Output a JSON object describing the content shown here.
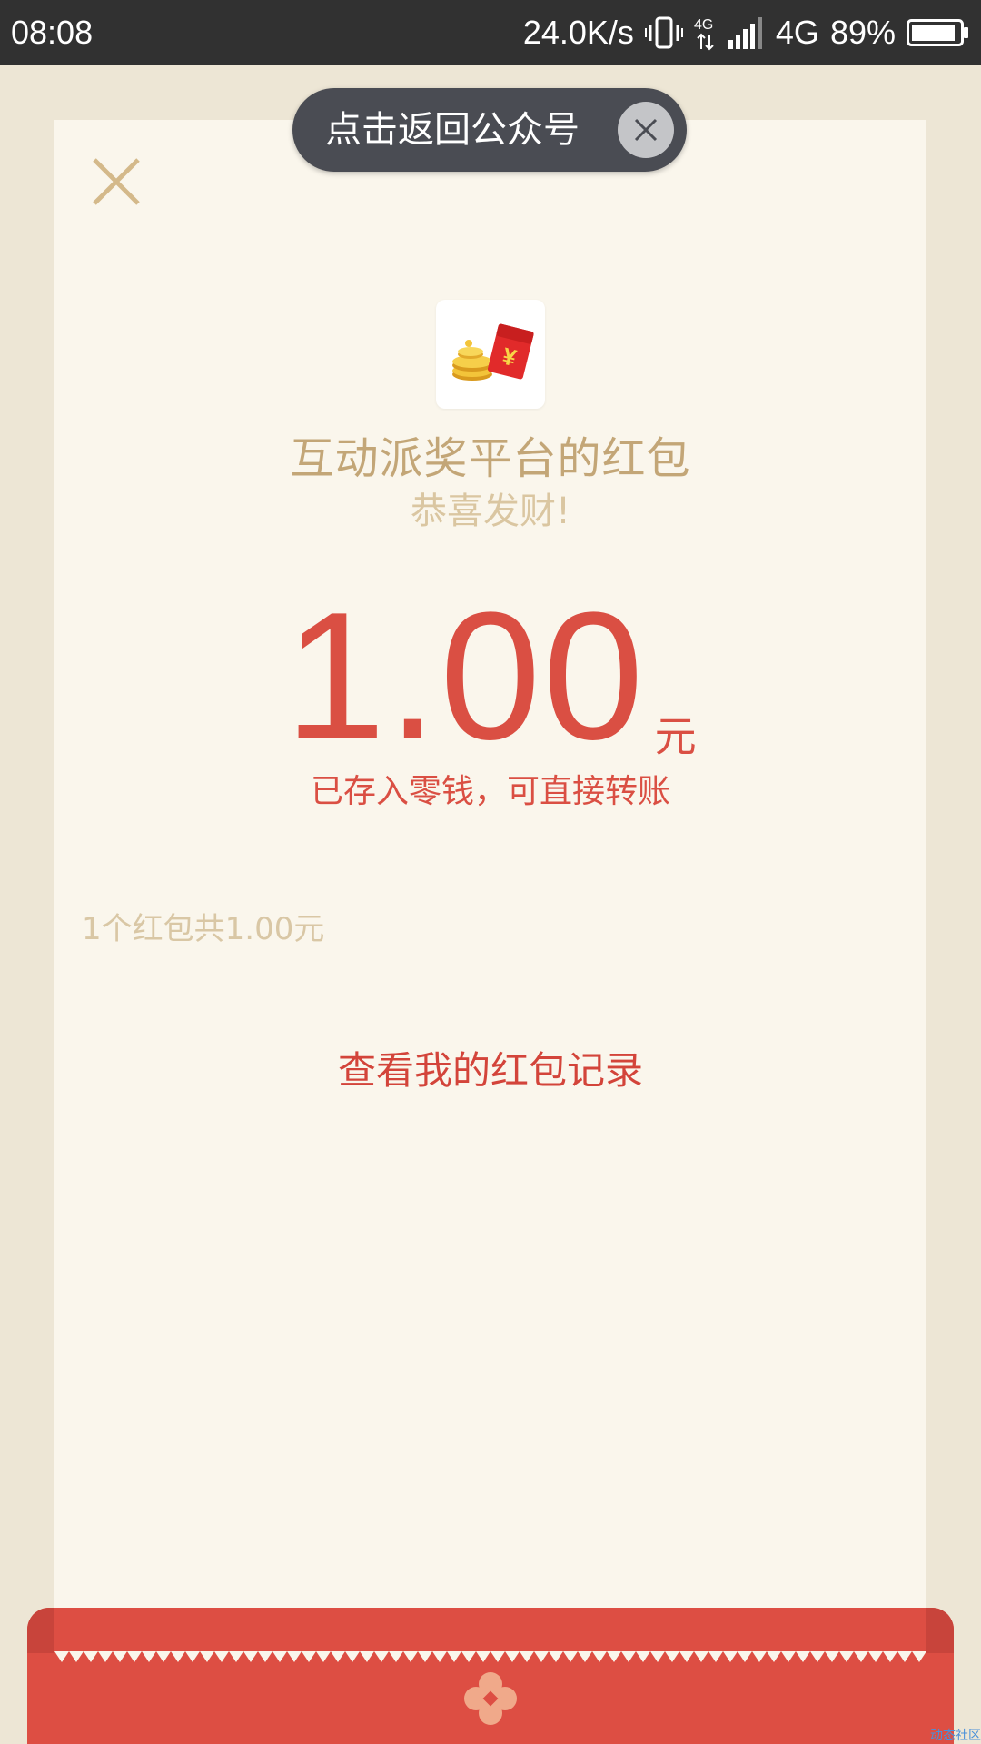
{
  "status_bar": {
    "time": "08:08",
    "net_speed": "24.0K/s",
    "network_type": "4G",
    "battery": "89%",
    "icons": [
      "vibrate-icon",
      "data-4g-icon",
      "signal-icon",
      "battery-icon"
    ]
  },
  "return_pill": {
    "label": "点击返回公众号"
  },
  "packet": {
    "sender": "互动派奖平台的红包",
    "blessing": "恭喜发财!",
    "amount": "1.00",
    "unit": "元",
    "note": "已存入零钱，可直接转账",
    "summary": "1个红包共1.00元",
    "records_link": "查看我的红包记录"
  },
  "watermark": "动态社区",
  "colors": {
    "accent_red": "#da4f43",
    "gold_text": "#c3a677",
    "paper": "#faf6ec",
    "background": "#ede6d5",
    "status_bar": "#313131"
  }
}
